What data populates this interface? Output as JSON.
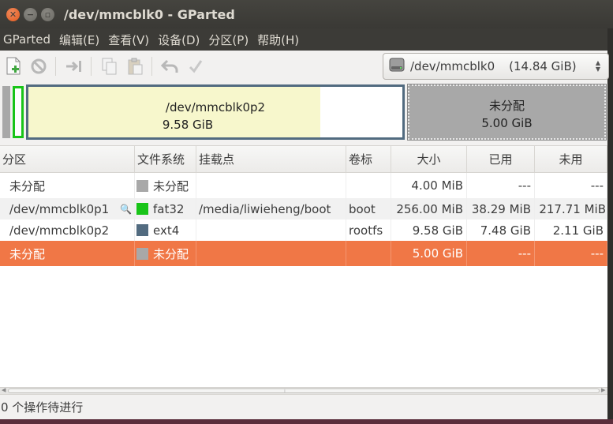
{
  "window": {
    "title": "/dev/mmcblk0 - GParted"
  },
  "menubar": [
    "GParted",
    "编辑(E)",
    "查看(V)",
    "设备(D)",
    "分区(P)",
    "帮助(H)"
  ],
  "toolbar": {
    "icons": [
      "new-partition-icon",
      "delete-icon",
      "resize-move-icon",
      "copy-icon",
      "paste-icon",
      "undo-icon",
      "apply-icon"
    ]
  },
  "device_selector": {
    "name": "/dev/mmcblk0",
    "size": "(14.84 GiB)"
  },
  "disk_map": {
    "ext4_label": "/dev/mmcblk0p2",
    "ext4_size": "9.58 GiB",
    "unalloc_label": "未分配",
    "unalloc_size": "5.00 GiB",
    "colors": {
      "fat32": "#18c418",
      "ext4": "#526b80",
      "used": "#f7f7cc",
      "unallocated": "#a8a8a8"
    }
  },
  "table": {
    "headers": [
      "分区",
      "文件系统",
      "挂载点",
      "卷标",
      "大小",
      "已用",
      "未用"
    ],
    "rows": [
      {
        "partition": "未分配",
        "fs": "未分配",
        "fs_color": "#a8a8a8",
        "mount": "",
        "label": "",
        "size": "4.00 MiB",
        "used": "---",
        "unused": "---"
      },
      {
        "partition": "/dev/mmcblk0p1",
        "fs": "fat32",
        "fs_color": "#18c418",
        "mount": "/media/liwieheng/boot",
        "label": "boot",
        "size": "256.00 MiB",
        "used": "38.29 MiB",
        "unused": "217.71 MiB"
      },
      {
        "partition": "/dev/mmcblk0p2",
        "fs": "ext4",
        "fs_color": "#526b80",
        "mount": "",
        "label": "rootfs",
        "size": "9.58 GiB",
        "used": "7.48 GiB",
        "unused": "2.11 GiB"
      },
      {
        "partition": "未分配",
        "fs": "未分配",
        "fs_color": "#a8a8a8",
        "mount": "",
        "label": "",
        "size": "5.00 GiB",
        "used": "---",
        "unused": "---"
      }
    ]
  },
  "status": {
    "text": "0 个操作待进行"
  },
  "accent": "#f07746"
}
